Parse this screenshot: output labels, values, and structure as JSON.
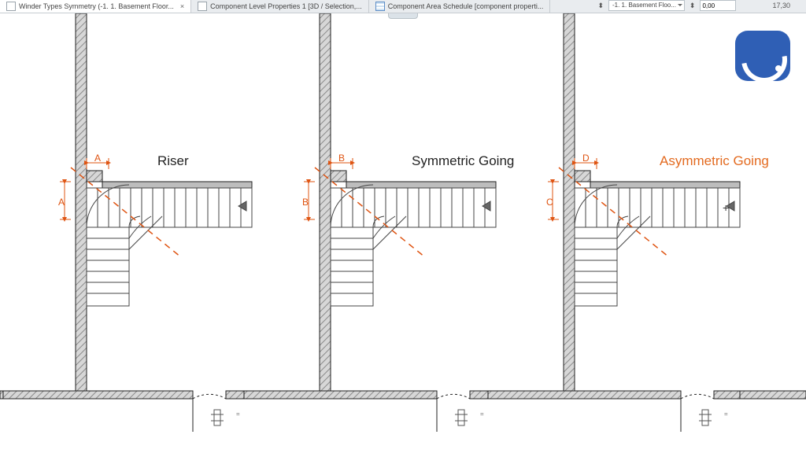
{
  "tabs": [
    {
      "label": "Winder Types Symmetry (-1. 1. Basement Floor...",
      "icon": "floorplan",
      "active": true,
      "closable": true
    },
    {
      "label": "Component Level Properties 1 [3D / Selection,...",
      "icon": "floorplan",
      "active": false,
      "closable": false
    },
    {
      "label": "Component Area Schedule [component properti...",
      "icon": "schedule",
      "active": false,
      "closable": false
    }
  ],
  "top_right": {
    "dropdown": "-1. 1. Basement Floo...",
    "field_value": "0,00",
    "zoom": "17,30"
  },
  "diagrams": [
    {
      "title": "Riser",
      "dim_top": "A",
      "dim_side": "A",
      "highlight": false
    },
    {
      "title": "Symmetric Going",
      "dim_top": "B",
      "dim_side": "B",
      "highlight": false
    },
    {
      "title": "Asymmetric Going",
      "dim_top": "D",
      "dim_side": "C",
      "highlight": true
    }
  ]
}
